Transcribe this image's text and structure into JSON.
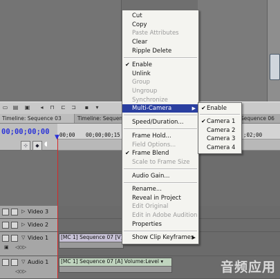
{
  "timeline": {
    "tabs": [
      "Timeline: Sequence 03",
      "Timeline: Sequence 0",
      "Sequence 06"
    ],
    "timecode": "00;00;00;00",
    "ruler_labels": [
      "00;00",
      "00;00;00;15",
      ";02;00"
    ]
  },
  "tracks": {
    "video3": "Video 3",
    "video2": "Video 2",
    "video1": "Video 1",
    "audio1": "Audio 1",
    "video1_clip": "[MC 1] Sequence 07 [V]",
    "audio1_clip": "[MC 1] Sequence 07 [A]  Volume:Level ▾"
  },
  "context_menu": {
    "cut": "Cut",
    "copy": "Copy",
    "paste_attributes": "Paste Attributes",
    "clear": "Clear",
    "ripple_delete": "Ripple Delete",
    "enable": "Enable",
    "unlink": "Unlink",
    "group": "Group",
    "ungroup": "Ungroup",
    "synchronize": "Synchronize",
    "multi_camera": "Multi-Camera",
    "speed_duration": "Speed/Duration...",
    "frame_hold": "Frame Hold...",
    "field_options": "Field Options...",
    "frame_blend": "Frame Blend",
    "scale_to_frame_size": "Scale to Frame Size",
    "audio_gain": "Audio Gain...",
    "rename": "Rename...",
    "reveal_in_project": "Reveal in Project",
    "edit_original": "Edit Original",
    "edit_in_adobe_audition": "Edit in Adobe Audition",
    "properties": "Properties",
    "show_clip_keyframes": "Show Clip Keyframes"
  },
  "submenu": {
    "enable": "Enable",
    "camera1": "Camera 1",
    "camera2": "Camera 2",
    "camera3": "Camera 3",
    "camera4": "Camera 4"
  },
  "icons": {
    "check": "✔",
    "submenu_arrow": "▶"
  },
  "watermark": "音频应用",
  "colors": {
    "menu_highlight": "#2a3fa0",
    "timecode": "#2a33d8",
    "playhead": "#d32a2a"
  }
}
